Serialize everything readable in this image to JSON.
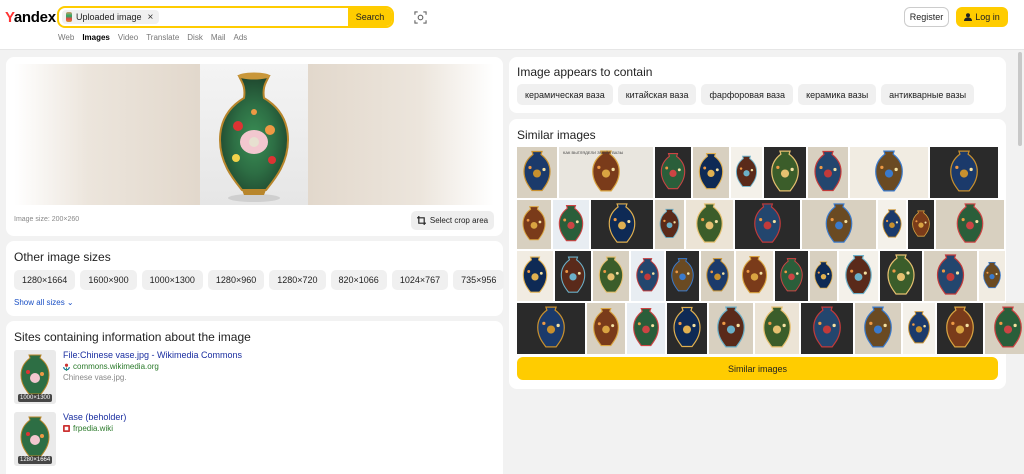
{
  "header": {
    "logo": "Yandex",
    "search_chip": "Uploaded image",
    "chip_close": "×",
    "search_button": "Search",
    "tabs": [
      "Web",
      "Images",
      "Video",
      "Translate",
      "Disk",
      "Mail",
      "Ads"
    ],
    "register": "Register",
    "login": "Log in"
  },
  "preview": {
    "image_size": "Image size: 200×260",
    "crop_button": "Select crop area"
  },
  "other_sizes": {
    "title": "Other image sizes",
    "sizes": [
      "1280×1664",
      "1600×900",
      "1000×1300",
      "1280×960",
      "1280×720",
      "820×1066",
      "1024×767",
      "735×956"
    ],
    "show_all": "Show all sizes"
  },
  "sites": {
    "title": "Sites containing information about the image",
    "items": [
      {
        "title": "File:Chinese vase.jpg - Wikimedia Commons",
        "domain": "commons.wikimedia.org",
        "desc": "Chinese vase.jpg.",
        "size": "1000×1300"
      },
      {
        "title": "Vase (beholder)",
        "domain": "frpedia.wiki",
        "desc": "",
        "size": "1280×1664"
      }
    ]
  },
  "contains": {
    "title": "Image appears to contain",
    "tags": [
      "керамическая ваза",
      "китайская ваза",
      "фарфоровая ваза",
      "керамика вазы",
      "антикварные вазы"
    ]
  },
  "similar": {
    "title": "Similar images",
    "button": "Similar images",
    "thumb_doc_caption": "КАК ВЫГЛЯДЕЛИ ЗМЕЙЛ ВАЗЫ"
  },
  "colors": {
    "accent": "#ffcc00",
    "link": "#1a2ea0",
    "domain": "#2b7a2b"
  }
}
